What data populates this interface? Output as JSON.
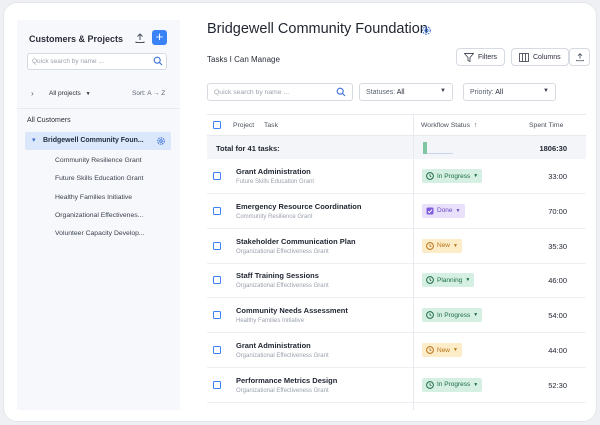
{
  "sidebar": {
    "title": "Customers & Projects",
    "search_placeholder": "Quick search by name ...",
    "project_filter": "All projects",
    "sort_label": "Sort:",
    "sort_value": "A → Z",
    "all_customers": "All Customers",
    "selected_customer": "Bridgewell Community Foun...",
    "projects": [
      "Community Resilience Grant",
      "Future Skills Education Grant",
      "Healthy Families Initiative",
      "Organizational Effectivenes...",
      "Volunteer Capacity Develop..."
    ]
  },
  "header": {
    "title": "Bridgewell Community Foundation",
    "subtitle": "Tasks I Can Manage",
    "filters_label": "Filters",
    "columns_label": "Columns"
  },
  "toolbar": {
    "search_placeholder": "Quick search by name ...",
    "statuses_label": "Statuses:",
    "statuses_value": "All",
    "priority_label": "Priority:",
    "priority_value": "All"
  },
  "table": {
    "columns": {
      "project": "Project",
      "task": "Task",
      "workflow_status": "Workflow Status",
      "spent_time": "Spent Time"
    },
    "total_label": "Total for 41 tasks:",
    "total_time": "1806:30",
    "rows": [
      {
        "task": "Grant Administration",
        "project": "Future Skills Education Grant",
        "status": "In Progress",
        "status_key": "inprogress",
        "spent": "33:00"
      },
      {
        "task": "Emergency Resource Coordination",
        "project": "Community Resilience Grant",
        "status": "Done",
        "status_key": "done",
        "spent": "70:00"
      },
      {
        "task": "Stakeholder Communication Plan",
        "project": "Organizational Effectiveness Grant",
        "status": "New",
        "status_key": "new",
        "spent": "35:30"
      },
      {
        "task": "Staff Training Sessions",
        "project": "Organizational Effectiveness Grant",
        "status": "Planning",
        "status_key": "planning",
        "spent": "46:00"
      },
      {
        "task": "Community Needs Assessment",
        "project": "Healthy Families Initiative",
        "status": "In Progress",
        "status_key": "inprogress",
        "spent": "54:00"
      },
      {
        "task": "Grant Administration",
        "project": "Organizational Effectiveness Grant",
        "status": "New",
        "status_key": "new",
        "spent": "44:00"
      },
      {
        "task": "Performance Metrics Design",
        "project": "Organizational Effectiveness Grant",
        "status": "In Progress",
        "status_key": "inprogress",
        "spent": "52:30"
      }
    ]
  },
  "colors": {
    "accent": "#3b82f6",
    "in_progress": "#d5f0e2",
    "done": "#e9e1fb",
    "new": "#fdecc8"
  }
}
